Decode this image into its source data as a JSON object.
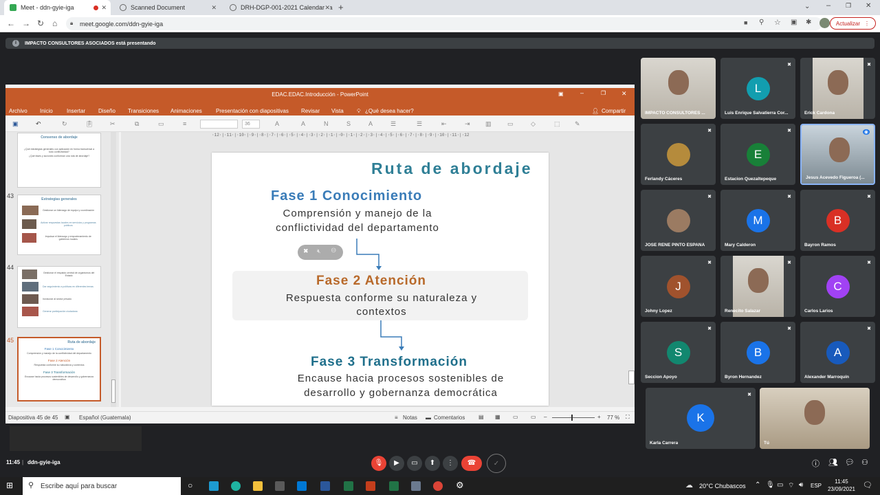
{
  "browser": {
    "tabs": [
      {
        "label": "Meet - ddn-gyie-iga",
        "active": true
      },
      {
        "label": "Scanned Document",
        "active": false
      },
      {
        "label": "DRH-DGP-001-2021 Calendariza",
        "active": false
      }
    ],
    "url": "meet.google.com/ddn-gyie-iga",
    "update_label": "Actualizar"
  },
  "banner": {
    "text": "IMPACTO CONSULTORES ASOCIADOS está presentando"
  },
  "ppt": {
    "window_title": "EDAC.EDAC.Introducción - PowerPoint",
    "menu": [
      "Archivo",
      "Inicio",
      "Insertar",
      "Diseño",
      "Transiciones",
      "Animaciones",
      "Presentación con diapositivas",
      "Revisar",
      "Vista"
    ],
    "tell_me": "¿Qué desea hacer?",
    "share": "Compartir",
    "font_size": "36",
    "thumbs": [
      {
        "num": "",
        "title": "Consenso de abordaje",
        "lines": [
          "¿Qué estrategias generales con aplicación en forma transversal a todo conflictividad?",
          "¿Qué fases y acciones conforman una ruta de abordaje?"
        ]
      },
      {
        "num": "43",
        "title": "Estrategias generales",
        "lines": [
          "Gestionar un liderazgo de equipo y coordinación",
          "Activar respuestas locales en servicios y programas públicos",
          "Impulsar el liderazgo y empoderamiento de gobiernos locales"
        ]
      },
      {
        "num": "44",
        "title": "",
        "lines": [
          "Gestionar el respaldo central de organismos del Estado",
          "Dar seguimiento a políticas en diferentes temas",
          "Involucrar al sector privado",
          "Generar participación ciudadana"
        ]
      },
      {
        "num": "45",
        "title": "Ruta de abordaje",
        "lines": [
          "Fase 1 Conocimiento",
          "Comprensión y manejo de la conflictividad del departamento",
          "Fase 2 Atención",
          "Respuesta conforme su naturaleza y contextos",
          "Fase 3 Transformación",
          "Encause hacia procesos sostenibles de desarrollo y gobernanza democrática"
        ]
      }
    ],
    "slide": {
      "title": "Ruta de abordaje",
      "phase1_title": "Fase 1 Conocimiento",
      "phase1_text": "Comprensión y manejo de la conflictividad del departamento",
      "phase2_title": "Fase 2 Atención",
      "phase2_text": "Respuesta conforme su naturaleza y contextos",
      "phase3_title": "Fase 3 Transformación",
      "phase3_text": "Encause hacia procesos sostenibles de desarrollo y gobernanza democrática"
    },
    "status": {
      "slide_count": "Diapositiva 45 de 45",
      "language": "Español (Guatemala)",
      "notes": "Notas",
      "comments": "Comentarios",
      "zoom": "77 %"
    }
  },
  "participants": [
    {
      "name": "IMPACTO CONSULTORES ...",
      "initial": "",
      "color": "#3c4043",
      "photo": true
    },
    {
      "name": "Luis Enrique Salvatierra Cor...",
      "initial": "L",
      "color": "#129eaf",
      "photo": false
    },
    {
      "name": "Erick Cardona",
      "initial": "",
      "color": "#3c4043",
      "photo": true
    },
    {
      "name": "Ferlandy Cáceres",
      "initial": "",
      "color": "#3c4043",
      "photo": false
    },
    {
      "name": "Estacion Quezaltepeque",
      "initial": "E",
      "color": "#188038",
      "photo": false
    },
    {
      "name": "Jesus Acevedo Figueroa (...",
      "initial": "",
      "color": "#3c4043",
      "photo": true
    },
    {
      "name": "JOSE RENE PINTO ESPAÑA",
      "initial": "",
      "color": "#3c4043",
      "photo": false
    },
    {
      "name": "Mary Calderon",
      "initial": "M",
      "color": "#1a73e8",
      "photo": false
    },
    {
      "name": "Bayron Ramos",
      "initial": "B",
      "color": "#d93025",
      "photo": false
    },
    {
      "name": "Johny Lopez",
      "initial": "J",
      "color": "#a0522d",
      "photo": false
    },
    {
      "name": "Renecito Salazar",
      "initial": "",
      "color": "#3c4043",
      "photo": true
    },
    {
      "name": "Carlos Larios",
      "initial": "C",
      "color": "#a142f4",
      "photo": false
    },
    {
      "name": "Seccion Apoyo",
      "initial": "S",
      "color": "#12876f",
      "photo": false
    },
    {
      "name": "Byron Hernandez",
      "initial": "B",
      "color": "#1a73e8",
      "photo": false
    },
    {
      "name": "Alexander Marroquín",
      "initial": "A",
      "color": "#185abc",
      "photo": false
    },
    {
      "name": "Karla Carrera",
      "initial": "K",
      "color": "#1a73e8",
      "photo": false
    },
    {
      "name": "Tú",
      "initial": "",
      "color": "#3c4043",
      "photo": true
    }
  ],
  "meet_bottom": {
    "time": "11:45",
    "code": "ddn-gyie-iga"
  },
  "taskbar": {
    "search_placeholder": "Escribe aquí para buscar",
    "weather": "20°C  Chubascos",
    "lang": "ESP",
    "clock_time": "11:45",
    "clock_date": "23/09/2021"
  }
}
